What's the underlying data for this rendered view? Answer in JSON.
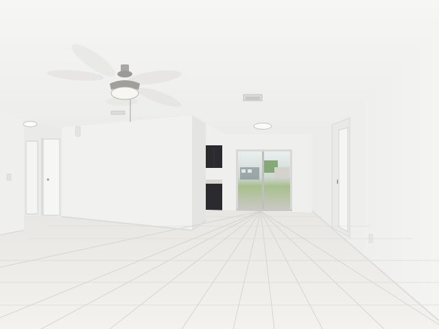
{
  "scene": {
    "description_free": true,
    "watermark_text": "",
    "colors": {
      "ceiling": "#f3f3f1",
      "wall": "#f1f1ef",
      "wall_shadow": "#e6e6e4",
      "floor": "#eeece8",
      "grout": "#d2d0cb",
      "baseboard": "#fafaf9",
      "cabinet": "#2b2a2e",
      "fan_metal": "#9c9a96",
      "glass_outside": "#9fb8a0"
    },
    "elements": {
      "ceiling_fan": "ceiling-fan",
      "ceiling_light": "ceiling-light",
      "air_vent": "air-vent",
      "sliding_door": "sliding-glass-door",
      "left_doors": "closet-doors",
      "right_door": "hallway-door",
      "kitchen_cabinets": "kitchen-cabinets",
      "tile_floor": "tile-floor"
    }
  }
}
